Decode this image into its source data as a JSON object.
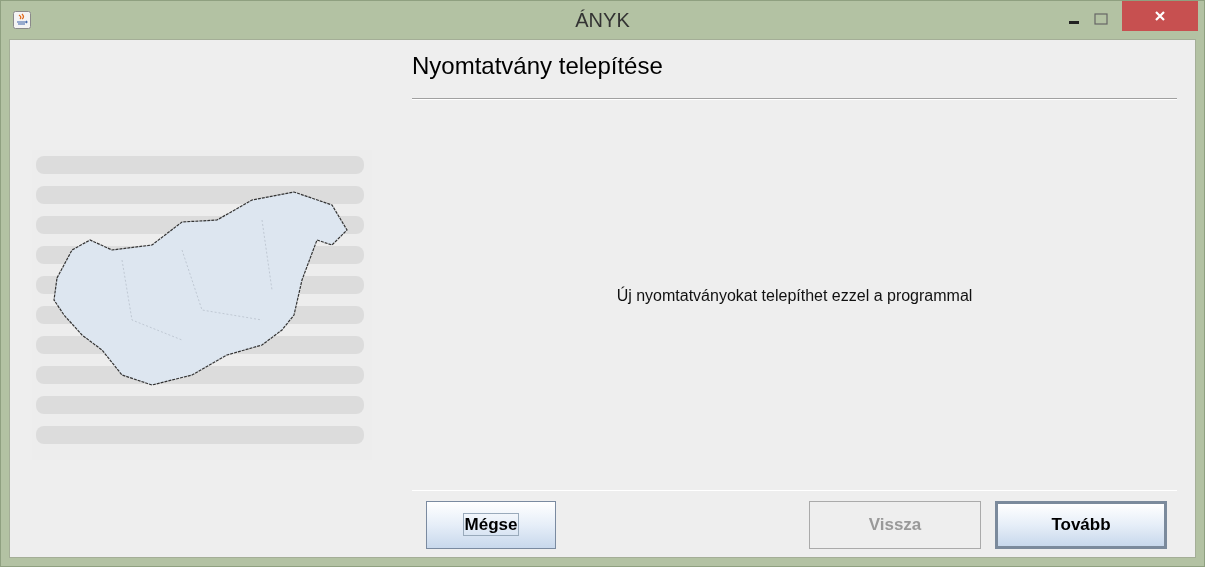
{
  "window": {
    "title": "ÁNYK"
  },
  "wizard": {
    "heading": "Nyomtatvány telepítése",
    "message": "Új nyomtatványokat telepíthet ezzel a programmal"
  },
  "buttons": [
    {
      "label": "Mégse",
      "disabled": false,
      "focused": true,
      "default": false
    },
    {
      "label": "Vissza",
      "disabled": true,
      "focused": false,
      "default": false
    },
    {
      "label": "Tovább",
      "disabled": false,
      "focused": false,
      "default": true
    }
  ]
}
